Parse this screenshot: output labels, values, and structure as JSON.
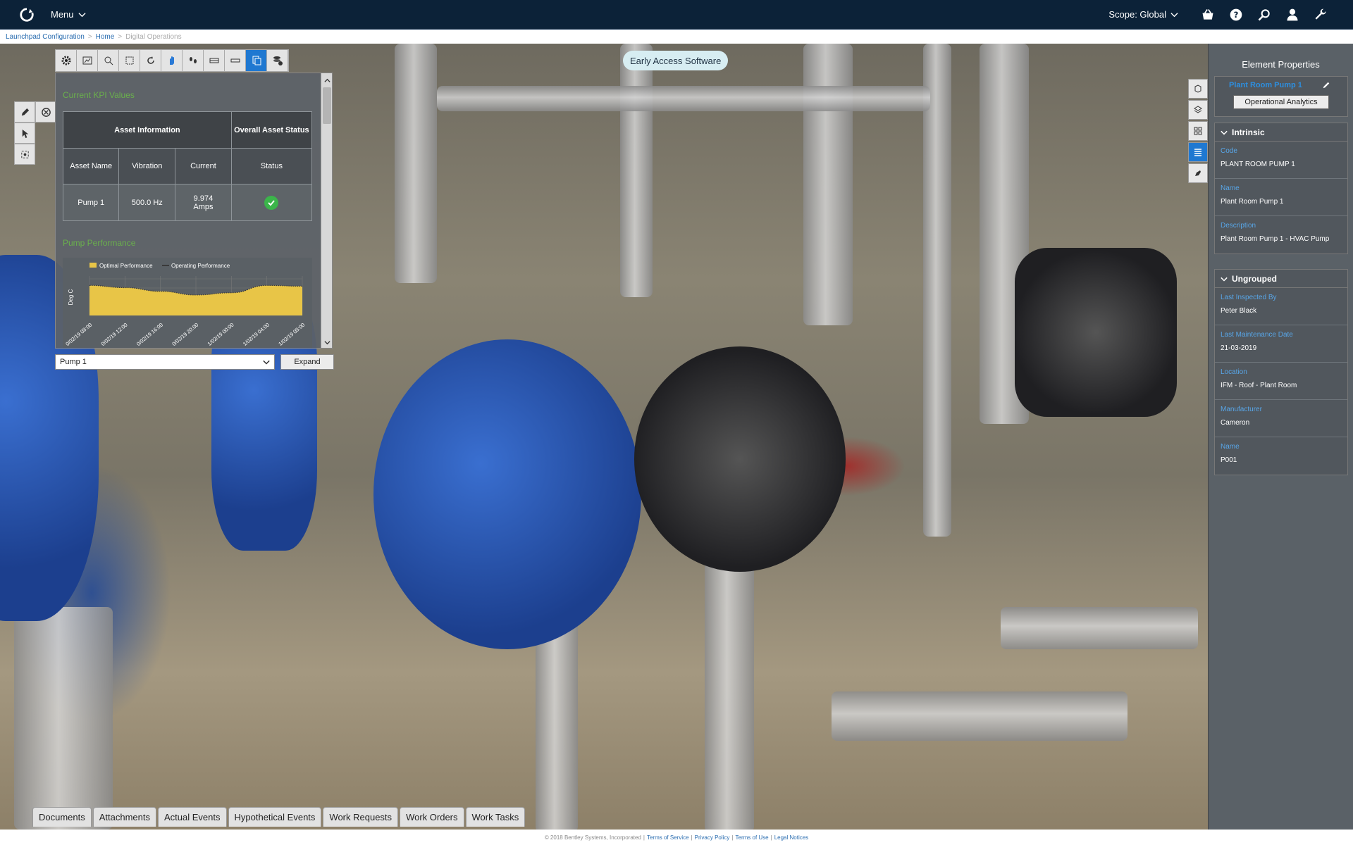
{
  "topbar": {
    "menu_label": "Menu",
    "scope_label": "Scope: Global",
    "icons": [
      "basket-icon",
      "help-icon",
      "search-icon",
      "user-icon",
      "wrench-icon"
    ]
  },
  "breadcrumb": {
    "items": [
      "Launchpad Configuration",
      "Home"
    ],
    "current": "Digital Operations"
  },
  "early_access": "Early Access Software",
  "kpi": {
    "title": "Current KPI Values",
    "header_group": "Asset Information",
    "header_status": "Overall Asset Status",
    "col_asset": "Asset Name",
    "col_vibration": "Vibration",
    "col_current": "Current",
    "col_status": "Status",
    "row": {
      "asset": "Pump 1",
      "vibration": "500.0 Hz",
      "current": "9.974 Amps",
      "status": "ok"
    },
    "perf_title": "Pump Performance",
    "selected_pump": "Pump 1",
    "expand_label": "Expand"
  },
  "chart_data": {
    "type": "area",
    "legend": [
      "Optimal Performance",
      "Operating Performance"
    ],
    "ylabel": "Deg C",
    "x": [
      "0/02/19 08:00",
      "0/02/19 12:00",
      "0/02/19 16:00",
      "0/02/19 20:00",
      "1/02/19 00:00",
      "1/02/19 04:00",
      "1/02/19 08:00"
    ],
    "series": [
      {
        "name": "Optimal Performance",
        "values": [
          0.82,
          0.76,
          0.66,
          0.56,
          0.62,
          0.82,
          0.8
        ]
      },
      {
        "name": "Operating Performance",
        "values": [
          0.82,
          0.76,
          0.66,
          0.56,
          0.62,
          0.82,
          0.8
        ]
      }
    ],
    "ylim": [
      0,
      1
    ],
    "colors": {
      "optimal": "#e8c547",
      "operating": "#3a3a3a"
    }
  },
  "props": {
    "title": "Element Properties",
    "element_name": "Plant Room Pump 1",
    "op_analytics": "Operational Analytics",
    "sections": [
      {
        "name": "Intrinsic",
        "items": [
          {
            "label": "Code",
            "value": "PLANT ROOM PUMP 1"
          },
          {
            "label": "Name",
            "value": "Plant Room Pump 1"
          },
          {
            "label": "Description",
            "value": "Plant Room Pump 1 - HVAC Pump"
          }
        ]
      },
      {
        "name": "Ungrouped",
        "items": [
          {
            "label": "Last Inspected By",
            "value": "Peter Black"
          },
          {
            "label": "Last Maintenance Date",
            "value": "21-03-2019"
          },
          {
            "label": "Location",
            "value": "IFM - Roof - Plant Room"
          },
          {
            "label": "Manufacturer",
            "value": "Cameron"
          },
          {
            "label": "Name",
            "value": "P001"
          }
        ]
      }
    ]
  },
  "tabs": [
    "Documents",
    "Attachments",
    "Actual Events",
    "Hypothetical Events",
    "Work Requests",
    "Work Orders",
    "Work Tasks"
  ],
  "footer": {
    "copyright": "© 2018 Bentley Systems, Incorporated",
    "links": [
      "Terms of Service",
      "Privacy Policy",
      "Terms of Use",
      "Legal Notices"
    ]
  }
}
